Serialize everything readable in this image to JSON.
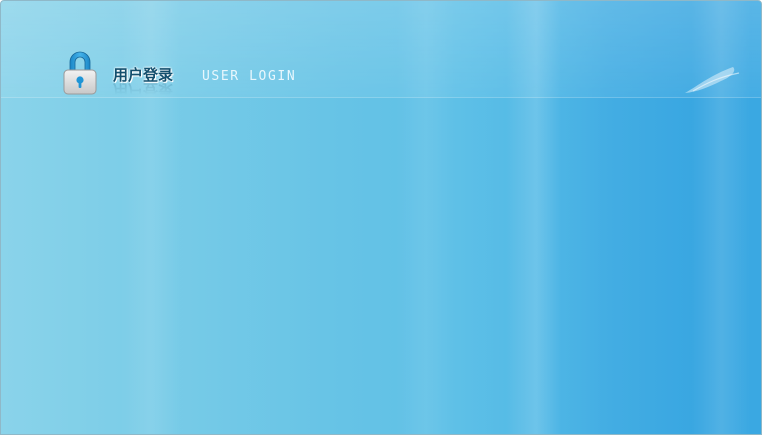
{
  "login": {
    "title_cn": "用户登录",
    "title_en": "USER LOGIN"
  },
  "icons": {
    "header": "lock-icon"
  },
  "colors": {
    "panel_left": "#8ad3ea",
    "panel_right": "#38a6e1",
    "title_cn": "#134f6e",
    "title_en": "#e8f7fd",
    "lock_shackle": "#1f95d6",
    "lock_body": "#d9d9d9"
  }
}
